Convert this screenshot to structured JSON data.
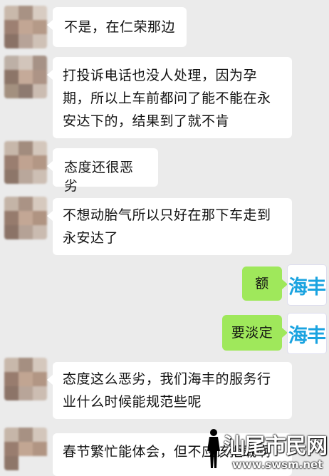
{
  "messages": [
    {
      "side": "left",
      "text": "不是，在仁荣那边"
    },
    {
      "side": "left",
      "text": "打投诉电话也没人处理，因为孕期，所以上车前都问了能不能在永安达下的，结果到了就不肯"
    },
    {
      "side": "left",
      "text": "态度还很恶劣"
    },
    {
      "side": "left",
      "text": "不想动胎气所以只好在那下车走到永安达了"
    },
    {
      "side": "right",
      "text": "额",
      "avatar_text": "海丰"
    },
    {
      "side": "right",
      "text": "要淡定",
      "avatar_text": "海丰"
    },
    {
      "side": "left",
      "text": "态度这么恶劣，我们海丰的服务行业什么时候能规范些呢"
    },
    {
      "side": "left",
      "text": "春节繁忙能体会，但不应该拒载啊"
    }
  ],
  "watermark": {
    "title": "汕尾市民网",
    "url": "www.swsm.net"
  },
  "colors": {
    "background": "#ebebeb",
    "incoming_bubble": "#ffffff",
    "outgoing_bubble": "#9fe85b",
    "logo_text": "#1aa3e0"
  }
}
